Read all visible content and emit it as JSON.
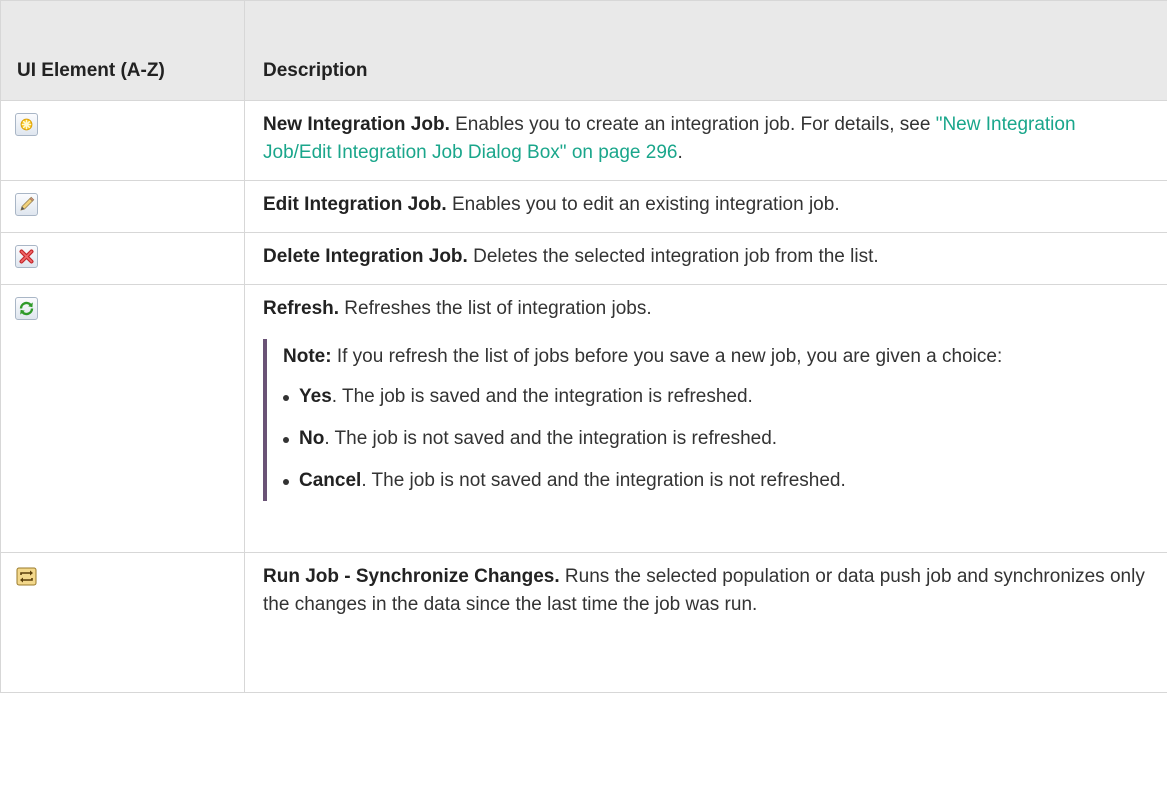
{
  "header": {
    "col1": "UI Element (A-Z)",
    "col2": "Description"
  },
  "rows": [
    {
      "icon": "new-asterisk-icon",
      "title": "New Integration Job.",
      "text": " Enables you to create an integration job. For details, see ",
      "link": "\"New Integration Job/Edit Integration Job Dialog Box\" on page 296",
      "after": "."
    },
    {
      "icon": "pencil-edit-icon",
      "title": "Edit Integration Job.",
      "text": " Enables you to edit an existing integration job."
    },
    {
      "icon": "red-x-delete-icon",
      "title": "Delete Integration Job.",
      "text": " Deletes the selected integration job from the list."
    },
    {
      "icon": "green-refresh-icon",
      "title": "Refresh.",
      "text": " Refreshes the list of integration jobs.",
      "note": {
        "label": "Note:",
        "text": " If you refresh the list of jobs before you save a new job, you are given a choice:",
        "items": [
          {
            "bold": "Yes",
            "text": ". The job is saved and the integration is refreshed."
          },
          {
            "bold": "No",
            "text": ". The job is not saved and the integration is refreshed."
          },
          {
            "bold": "Cancel",
            "text": ". The job is not saved and the integration is not refreshed."
          }
        ]
      }
    },
    {
      "icon": "sync-changes-icon",
      "title": "Run Job - Synchronize Changes.",
      "text": " Runs the selected population or data push job and synchronizes only the changes in the data since the last time the job was run."
    }
  ]
}
